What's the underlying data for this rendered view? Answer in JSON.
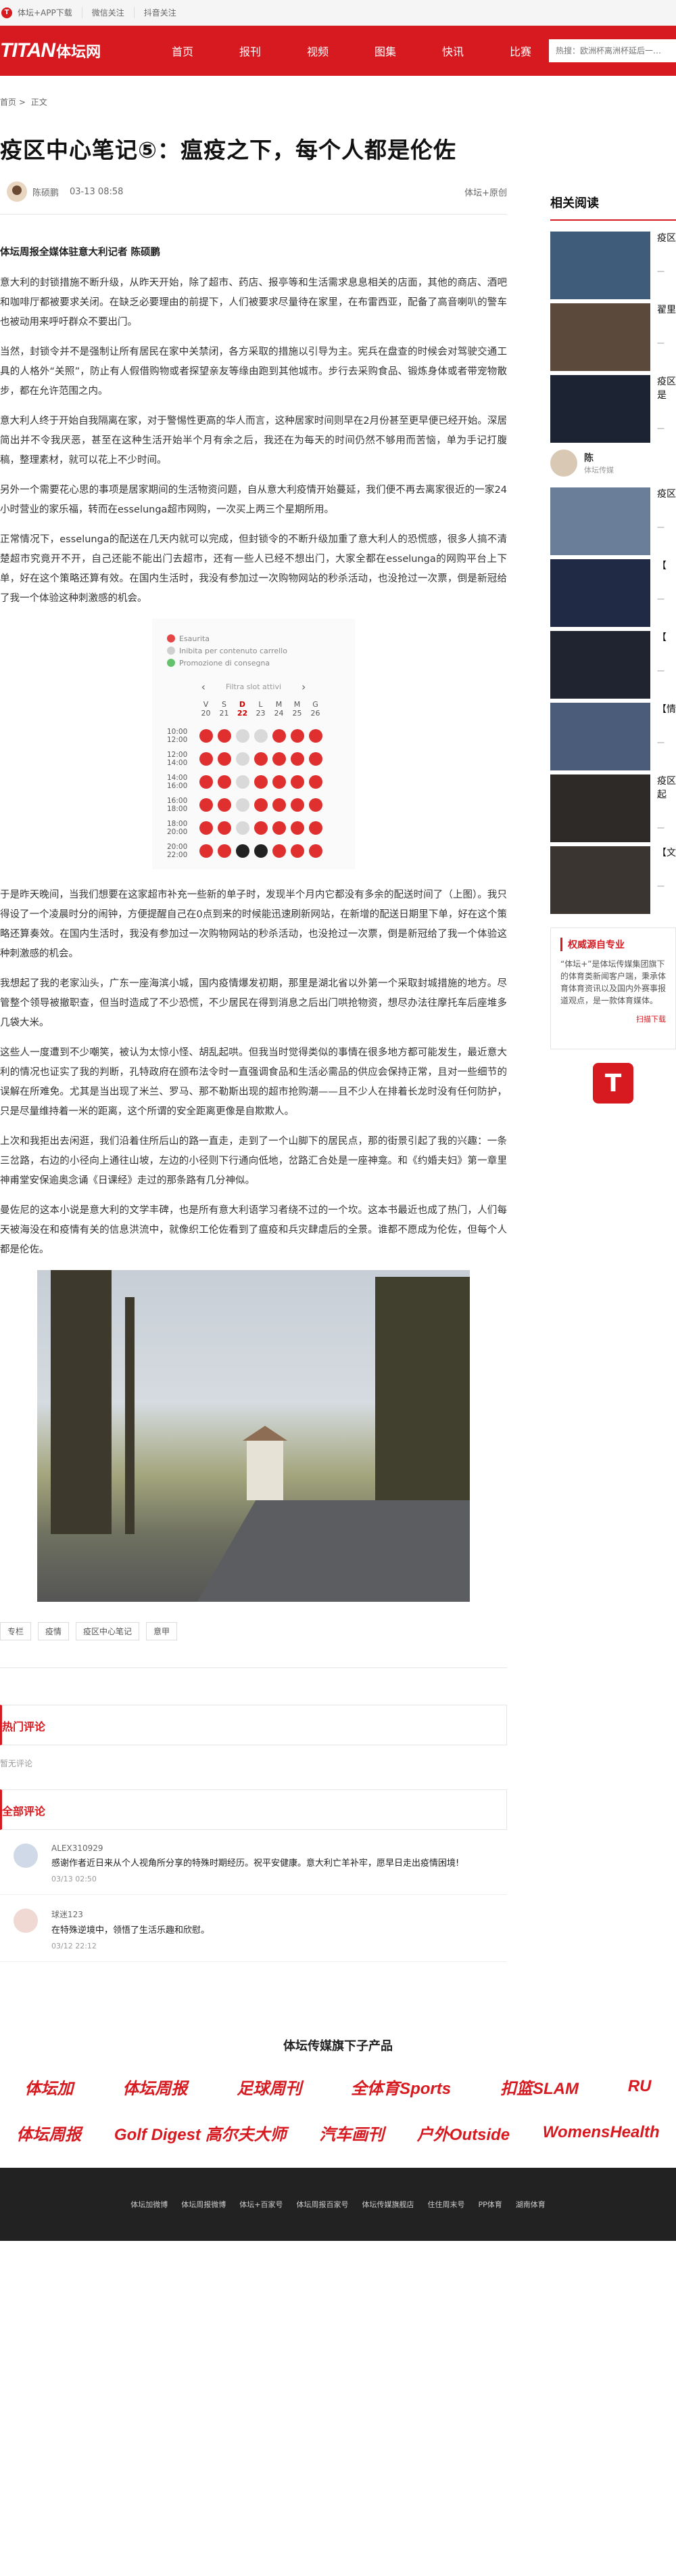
{
  "topbar": {
    "links": [
      "体坛+APP下载",
      "微信关注",
      "抖音关注"
    ]
  },
  "nav": {
    "brand_mark": "TITAN",
    "brand_cn": "体坛网",
    "items": [
      "首页",
      "报刊",
      "视频",
      "图集",
      "快讯",
      "比赛"
    ],
    "search_placeholder": "热搜：欧洲杯离洲杯延后一…"
  },
  "breadcrumb": [
    "首页",
    ">",
    "正文"
  ],
  "article": {
    "title": "疫区中心笔记⑤：瘟疫之下，每个人都是伦佐",
    "author": "陈硕鹏",
    "date": "03-13 08:58",
    "source": "体坛+原创",
    "lead": "体坛周报全媒体驻意大利记者 陈硕鹏",
    "paragraphs": [
      "意大利的封锁措施不断升级，从昨天开始，除了超市、药店、报亭等和生活需求息息相关的店面，其他的商店、酒吧和咖啡厅都被要求关闭。在缺乏必要理由的前提下，人们被要求尽量待在家里，在布雷西亚，配备了高音喇叭的警车也被动用来呼吁群众不要出门。",
      "当然，封锁令并不是强制让所有居民在家中关禁闭，各方采取的措施以引导为主。宪兵在盘查的时候会对驾驶交通工具的人格外“关照”，防止有人假借购物或者探望亲友等缘由跑到其他城市。步行去采购食品、锻炼身体或者带宠物散步，都在允许范围之内。",
      "意大利人终于开始自我隔离在家，对于警惕性更高的华人而言，这种居家时间则早在2月份甚至更早便已经开始。深居简出并不令我厌恶，甚至在这种生活开始半个月有余之后，我还在为每天的时间仍然不够用而苦恼，单为手记打腹稿，整理素材，就可以花上不少时间。",
      "另外一个需要花心思的事项是居家期间的生活物资问题，自从意大利疫情开始蔓延，我们便不再去离家很近的一家24小时营业的家乐福，转而在esselunga超市网购，一次买上两三个星期所用。",
      "正常情况下，esselunga的配送在几天内就可以完成，但封锁令的不断升级加重了意大利人的恐慌感，很多人搞不清楚超市究竟开不开，自己还能不能出门去超市，还有一些人已经不想出门，大家全都在esselunga的网购平台上下单，好在这个策略还算有效。在国内生活时，我没有参加过一次购物网站的秒杀活动，也没抢过一次票，倒是新冠给了我一个体验这种刺激感的机会。",
      "于是昨天晚间，当我们想要在这家超市补充一些新的单子时，发现半个月内它都没有多余的配送时间了（上图）。我只得设了一个凌晨时分的闹钟，方便提醒自己在0点到来的时候能迅速刷新网站，在新增的配送日期里下单，好在这个策略还算奏效。在国内生活时，我没有参加过一次购物网站的秒杀活动，也没抢过一次票，倒是新冠给了我一个体验这种刺激感的机会。",
      "我想起了我的老家汕头，广东一座海滨小城，国内疫情爆发初期，那里是湖北省以外第一个采取封城措施的地方。尽管整个领导被撤职查，但当时造成了不少恐慌，不少居民在得到消息之后出门哄抢物资，想尽办法往摩托车后座堆多几袋大米。",
      "这些人一度遭到不少嘲笑，被认为太惊小怪、胡乱起哄。但我当时觉得类似的事情在很多地方都可能发生，最近意大利的情况也证实了我的判断，孔特政府在颁布法令时一直强调食品和生活必需品的供应会保持正常，且对一些细节的误解在所难免。尤其是当出现了米兰、罗马、那不勒斯出现的超市抢购潮——且不少人在排着长龙时没有任何防护，只是尽量维持着一米的距离，这个所谓的安全距离更像是自欺欺人。",
      "上次和我拒出去闲逛，我们沿着住所后山的路一直走，走到了一个山脚下的居民点，那的街景引起了我的兴趣：一条三岔路，右边的小径向上通往山坡，左边的小径则下行通向低地，岔路汇合处是一座神龛。和《约婚夫妇》第一章里神甫堂安保逾奥念诵《日课经》走过的那条路有几分神似。",
      "曼佐尼的这本小说是意大利的文学丰碑，也是所有意大利语学习者绕不过的一个坎。这本书最近也成了热门，人们每天被海没在和疫情有关的信息洪流中，就像织工伦佐看到了瘟疫和兵灾肆虐后的全景。谁都不愿成为伦佐，但每个人都是伦佐。"
    ],
    "booking": {
      "legend": [
        "Esaurita",
        "Inibita per contenuto carrello",
        "Promozione di consegna"
      ],
      "filter": "Filtra slot attivi",
      "days": [
        {
          "w": "V",
          "d": "20"
        },
        {
          "w": "S",
          "d": "21"
        },
        {
          "w": "D",
          "d": "22"
        },
        {
          "w": "L",
          "d": "23"
        },
        {
          "w": "M",
          "d": "24"
        },
        {
          "w": "M",
          "d": "25"
        },
        {
          "w": "G",
          "d": "26"
        }
      ],
      "times": [
        "10:00\n12:00",
        "12:00\n14:00",
        "14:00\n16:00",
        "16:00\n18:00",
        "18:00\n20:00",
        "20:00\n22:00"
      ],
      "grid": [
        [
          "r",
          "r",
          "g",
          "g",
          "r",
          "r",
          "r"
        ],
        [
          "r",
          "r",
          "g",
          "r",
          "r",
          "r",
          "r"
        ],
        [
          "r",
          "r",
          "g",
          "r",
          "r",
          "r",
          "r"
        ],
        [
          "r",
          "r",
          "g",
          "r",
          "r",
          "r",
          "r"
        ],
        [
          "r",
          "r",
          "g",
          "r",
          "r",
          "r",
          "r"
        ],
        [
          "r",
          "r",
          "k",
          "k",
          "r",
          "r",
          "r"
        ]
      ]
    },
    "tags": [
      "专栏",
      "疫情",
      "疫区中心笔记",
      "意甲"
    ]
  },
  "comments": {
    "hot_title": "热门评论",
    "hot_empty": "暂无评论",
    "all_title": "全部评论",
    "items": [
      {
        "name": "ALEX310929",
        "text": "感谢作者近日来从个人视角所分享的特殊时期经历。祝平安健康。意大利亡羊补牢，愿早日走出疫情困境!",
        "time": "03/13 02:50"
      },
      {
        "name": "球迷123",
        "text": "在特殊逆境中，领悟了生活乐趣和欣慰。",
        "time": "03/12 22:12"
      }
    ]
  },
  "sidebar": {
    "title": "相关阅读",
    "items": [
      {
        "title": "疫区",
        "time": "一"
      },
      {
        "title": "翟里",
        "time": "一"
      },
      {
        "title": "疫区是",
        "time": "一"
      },
      {
        "title": "疫区",
        "time": "一"
      },
      {
        "title": "【",
        "time": "一"
      },
      {
        "title": "【",
        "time": "一"
      },
      {
        "title": "【情",
        "time": "一"
      },
      {
        "title": "疫区起",
        "time": "一"
      },
      {
        "title": "【文",
        "time": "一"
      }
    ],
    "ad_name": "陈",
    "ad_sub": "体坛传媒",
    "auth_title": "权威源自专业",
    "auth_text": "“体坛+”是体坛传媒集团旗下的体育类新闻客户端，秉承体育体育资讯以及国内外赛事报道观点，是一款体育媒体。",
    "auth_link": "扫描下载",
    "logo": "T"
  },
  "brands": {
    "title": "体坛传媒旗下子产品",
    "row1": [
      "体坛加",
      "体坛周报",
      "足球周刊",
      "全体育Sports",
      "扣篮SLAM",
      "RU"
    ],
    "row2": [
      "体坛周报",
      "Golf Digest 高尔夫大师",
      "汽车画刊",
      "户外Outside",
      "WomensHealth"
    ]
  },
  "footer": {
    "links": [
      "体坛加微博",
      "体坛周报微博",
      "体坛+百家号",
      "体坛周报百家号",
      "体坛传媒旗舰店",
      "住住周末号",
      "PP体育",
      "湖南体育"
    ]
  }
}
